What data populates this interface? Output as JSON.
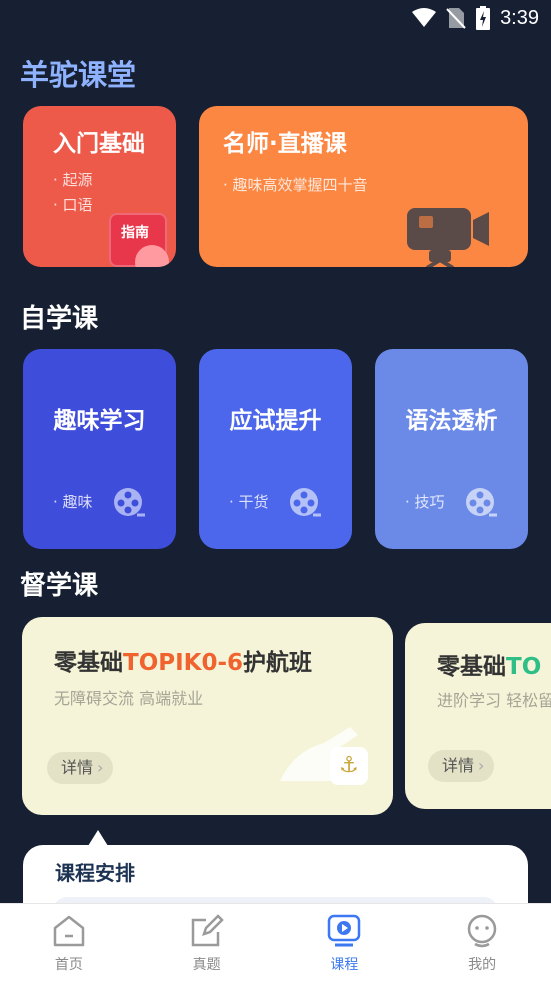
{
  "status_bar": {
    "time": "3:39"
  },
  "app_title": "羊驼课堂",
  "top_cards": {
    "intro": {
      "title": "入门基础",
      "items": [
        "· 起源",
        "· 口语"
      ],
      "badge": "指南"
    },
    "live": {
      "title": "名师·直播课",
      "subtitle": "· 趣味高效掌握四十音"
    }
  },
  "sections": {
    "self_study": "自学课",
    "supervised": "督学课"
  },
  "self_cards": [
    {
      "title": "趣味学习",
      "tag": "· 趣味",
      "color": "#3f4ddb"
    },
    {
      "title": "应试提升",
      "tag": "· 干货",
      "color": "#4c67eb"
    },
    {
      "title": "语法透析",
      "tag": "· 技巧",
      "color": "#6b8ae8"
    }
  ],
  "supervised_cards": [
    {
      "title_prefix": "零基础",
      "title_highlight": "TOPIK0-6",
      "title_suffix": "护航班",
      "highlight_color": "#f0632f",
      "subtitle": "无障碍交流 高端就业",
      "button": "详情"
    },
    {
      "title_prefix": "零基础",
      "title_highlight": "TO",
      "title_suffix": "",
      "highlight_color": "#2fbf86",
      "subtitle": "进阶学习 轻松留",
      "button": "详情"
    }
  ],
  "schedule": {
    "title": "课程安排"
  },
  "tabbar": [
    {
      "label": "首页",
      "icon": "home-icon",
      "active": false
    },
    {
      "label": "真题",
      "icon": "edit-icon",
      "active": false
    },
    {
      "label": "课程",
      "icon": "course-play-icon",
      "active": true
    },
    {
      "label": "我的",
      "icon": "profile-icon",
      "active": false
    }
  ]
}
